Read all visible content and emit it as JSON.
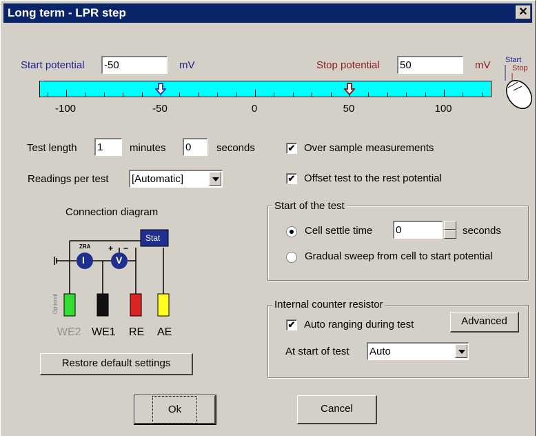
{
  "window": {
    "title": "Long term - LPR step",
    "close_label": "✕"
  },
  "potentials": {
    "start_label": "Start potential",
    "start_value": "-50",
    "start_unit": "mV",
    "stop_label": "Stop potential",
    "stop_value": "50",
    "stop_unit": "mV",
    "mouse_start": "Start",
    "mouse_stop": "Stop"
  },
  "scale": {
    "ticks": [
      "-100",
      "-50",
      "0",
      "50",
      "100"
    ],
    "start_marker_value": -50,
    "stop_marker_value": 50,
    "colors": {
      "bar": "#00ffff",
      "start_arrow": "#1f3fbf",
      "stop_arrow": "#8f1f1f"
    }
  },
  "test_length": {
    "label": "Test length",
    "minutes_value": "1",
    "minutes_label": "minutes",
    "seconds_value": "0",
    "seconds_label": "seconds"
  },
  "readings": {
    "label": "Readings per test",
    "value": "[Automatic]"
  },
  "options": {
    "over_sample": {
      "label": "Over sample measurements",
      "checked": true
    },
    "offset_rest": {
      "label": "Offset test to the rest potential",
      "checked": true
    }
  },
  "start_of_test": {
    "title": "Start of the test",
    "cell_settle": {
      "label": "Cell settle time",
      "value": "0",
      "unit": "seconds",
      "selected": true
    },
    "gradual_sweep": {
      "label": "Gradual sweep from cell to start potential",
      "selected": false
    }
  },
  "diagram": {
    "title": "Connection diagram",
    "stat_label": "Stat",
    "zra_label": "ZRA",
    "i_label": "I",
    "v_label": "V",
    "plus": "+",
    "minus": "−",
    "optional_label": "Optional",
    "electrodes": [
      {
        "label": "WE2",
        "color": "#33dd33"
      },
      {
        "label": "WE1",
        "color": "#111111"
      },
      {
        "label": "RE",
        "color": "#dd2222"
      },
      {
        "label": "AE",
        "color": "#ffff22"
      }
    ]
  },
  "resistor": {
    "title": "Internal counter resistor",
    "auto_ranging": {
      "label": "Auto ranging during test",
      "checked": true
    },
    "advanced_label": "Advanced",
    "at_start_label": "At start of test",
    "at_start_value": "Auto"
  },
  "buttons": {
    "restore": "Restore default settings",
    "ok": "Ok",
    "cancel": "Cancel"
  }
}
